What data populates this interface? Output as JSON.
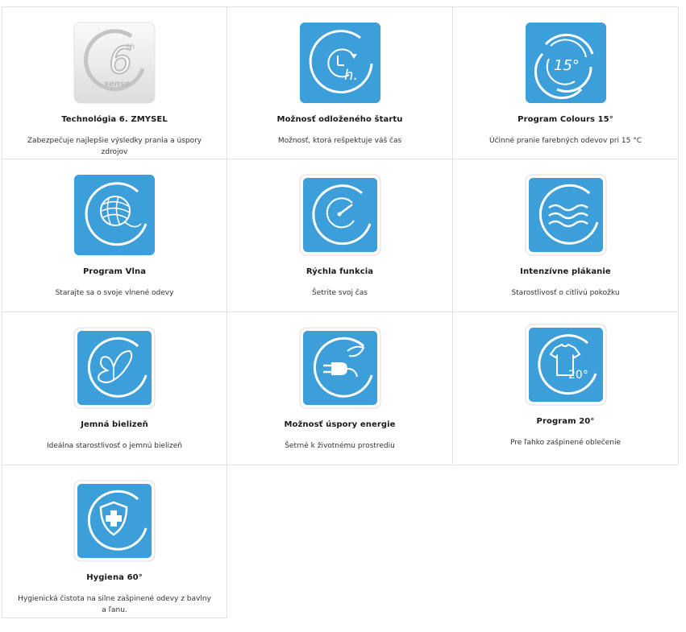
{
  "features": [
    {
      "title": "Technológia 6. ZMYSEL",
      "desc": "Zabezpečuje najlepšie výsledky prania a úspory zdrojov",
      "icon": "sixth-sense-icon",
      "icon_text_main": "6",
      "icon_text_sup": "th",
      "icon_text_sub": "sense"
    },
    {
      "title": "Možnosť odloženého štartu",
      "desc": "Možnosť, ktorá rešpektuje váš čas",
      "icon": "delay-start-clock-icon",
      "icon_text": "h."
    },
    {
      "title": "Program Colours 15°",
      "desc": "Účinné pranie farebných odevov pri 15 °C",
      "icon": "colours-15-icon",
      "icon_text": "15°"
    },
    {
      "title": "Program Vlna",
      "desc": "Starajte sa o svoje vlnené odevy",
      "icon": "wool-yarn-icon"
    },
    {
      "title": "Rýchla funkcia",
      "desc": "Šetrite svoj čas",
      "icon": "speedometer-icon"
    },
    {
      "title": "Intenzívne plákanie",
      "desc": "Starostlivosť o citlivú pokožku",
      "icon": "water-waves-icon"
    },
    {
      "title": "Jemná bielizeň",
      "desc": "Ideálna starostlivosť o jemnú bielizeň",
      "icon": "butterfly-icon"
    },
    {
      "title": "Možnosť úspory energie",
      "desc": "Šetrné k životnému prostrediu",
      "icon": "eco-plug-icon"
    },
    {
      "title": "Program 20°",
      "desc": "Pre ľahko zašpinené oblečenie",
      "icon": "tshirt-20-icon",
      "icon_text": "20°"
    },
    {
      "title": "Hygiena 60°",
      "desc": "Hygienická čistota na silne zašpinené odevy z bavlny a ľanu.",
      "icon": "shield-cross-icon"
    }
  ],
  "colors": {
    "icon_blue": "#3d9fd9",
    "icon_blue_dark": "#2f8cc8",
    "border": "#e3e3e3",
    "sense_gray": "#cfcfcf"
  }
}
